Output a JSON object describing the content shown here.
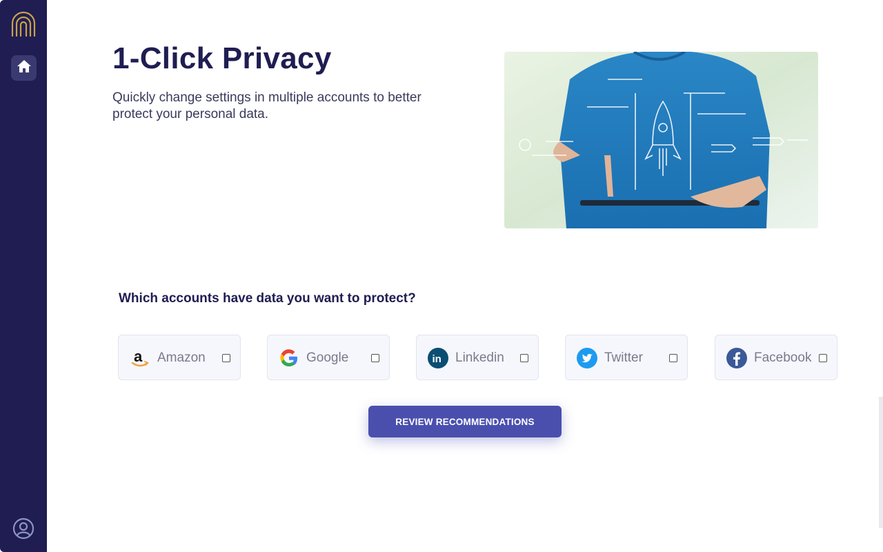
{
  "sidebar": {
    "logo_icon": "fingerprint-arch-logo",
    "home_icon": "home-icon",
    "profile_icon": "user-circle-icon"
  },
  "header": {
    "title": "1-Click Privacy",
    "subtitle": "Quickly change settings in multiple accounts to better protect your personal data."
  },
  "hero_image": {
    "icon": "rocket-icon"
  },
  "question": "Which accounts have data you want to protect?",
  "accounts": [
    {
      "label": "Amazon",
      "icon": "amazon-icon",
      "checked": false
    },
    {
      "label": "Google",
      "icon": "google-icon",
      "checked": false
    },
    {
      "label": "Linkedin",
      "icon": "linkedin-icon",
      "checked": false
    },
    {
      "label": "Twitter",
      "icon": "twitter-icon",
      "checked": false
    },
    {
      "label": "Facebook",
      "icon": "facebook-icon",
      "checked": false
    }
  ],
  "review_button": "REVIEW RECOMMENDATIONS",
  "colors": {
    "sidebar": "#1f1d52",
    "accent": "#4a4fae",
    "logo_gold": "#c9a24a",
    "title": "#1f1d52"
  }
}
